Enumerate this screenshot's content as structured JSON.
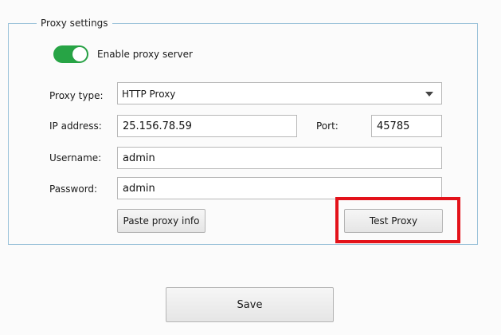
{
  "proxy_settings": {
    "group_title": "Proxy settings",
    "enable": {
      "label": "Enable proxy server",
      "checked": true,
      "color": "#27a445"
    },
    "proxy_type": {
      "label": "Proxy type:",
      "value": "HTTP Proxy"
    },
    "ip_address": {
      "label": "IP address:",
      "value": "25.156.78.59"
    },
    "port": {
      "label": "Port:",
      "value": "45785"
    },
    "username": {
      "label": "Username:",
      "value": "admin"
    },
    "password": {
      "label": "Password:",
      "value": "admin"
    },
    "paste_button": "Paste proxy info",
    "test_button": "Test Proxy",
    "highlight_color": "#e3121a"
  },
  "footer": {
    "save_button": "Save"
  }
}
